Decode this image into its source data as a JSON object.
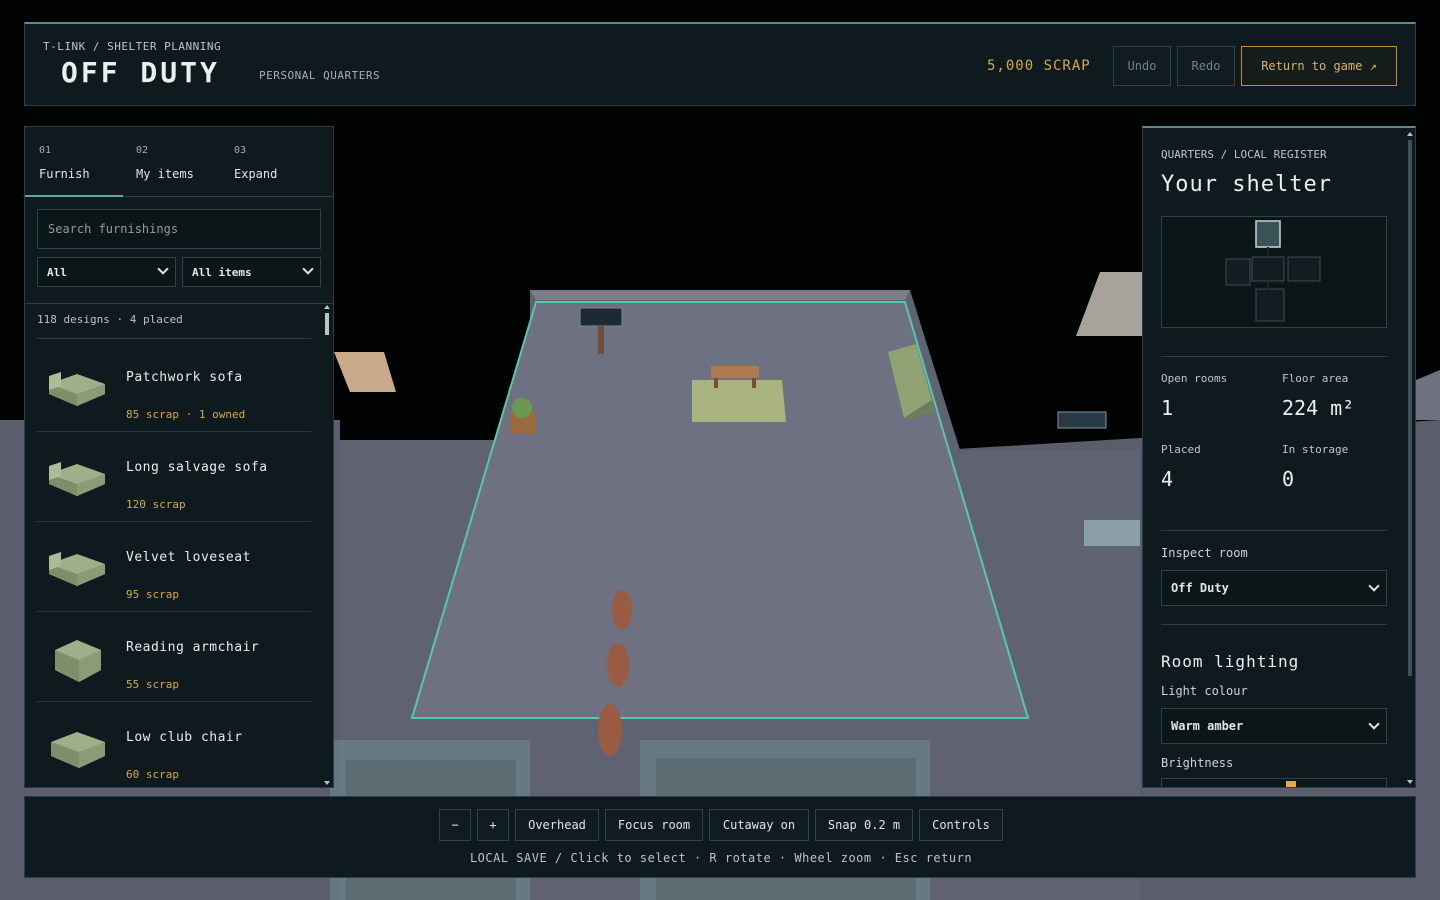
{
  "header": {
    "breadcrumb": "T-LINK / SHELTER PLANNING",
    "title": "OFF DUTY",
    "subtitle": "PERSONAL QUARTERS",
    "scrap": "5,000 SCRAP",
    "undo_label": "Undo",
    "redo_label": "Redo",
    "return_label": "Return to game ↗"
  },
  "sidebar": {
    "tabs": [
      {
        "num": "01",
        "label": "Furnish"
      },
      {
        "num": "02",
        "label": "My items"
      },
      {
        "num": "03",
        "label": "Expand"
      }
    ],
    "search": {
      "placeholder": "Search furnishings",
      "value": ""
    },
    "filter_category": "All",
    "filter_owned": "All items",
    "count": "118 designs · 4 placed",
    "items": [
      {
        "name": "Patchwork sofa",
        "price": "85 scrap · 1 owned",
        "icon": "sofa-icon"
      },
      {
        "name": "Long salvage sofa",
        "price": "120 scrap",
        "icon": "sofa-icon"
      },
      {
        "name": "Velvet loveseat",
        "price": "95 scrap",
        "icon": "sofa-icon"
      },
      {
        "name": "Reading armchair",
        "price": "55 scrap",
        "icon": "armchair-icon"
      },
      {
        "name": "Low club chair",
        "price": "60 scrap",
        "icon": "armchair-icon"
      }
    ]
  },
  "inspector": {
    "breadcrumb": "QUARTERS / LOCAL REGISTER",
    "title": "Your shelter",
    "stats": {
      "open_rooms_label": "Open rooms",
      "open_rooms": "1",
      "floor_area_label": "Floor area",
      "floor_area": "224 m²",
      "placed_label": "Placed",
      "placed": "4",
      "storage_label": "In storage",
      "storage": "0"
    },
    "inspect_label": "Inspect room",
    "inspect_value": "Off Duty",
    "lighting_title": "Room lighting",
    "light_colour_label": "Light colour",
    "light_colour_value": "Warm amber",
    "brightness_label": "Brightness",
    "brightness": 0.58
  },
  "toolbar": {
    "zoom_out": "−",
    "zoom_in": "+",
    "overhead": "Overhead",
    "focus": "Focus room",
    "cutaway": "Cutaway on",
    "snap": "Snap 0.2 m",
    "controls": "Controls",
    "hint": "LOCAL SAVE / Click to select · R rotate · Wheel zoom · Esc return"
  },
  "colors": {
    "accent": "#5fc7a8",
    "scrap": "#d8a652",
    "return_border": "#c68c3d"
  }
}
